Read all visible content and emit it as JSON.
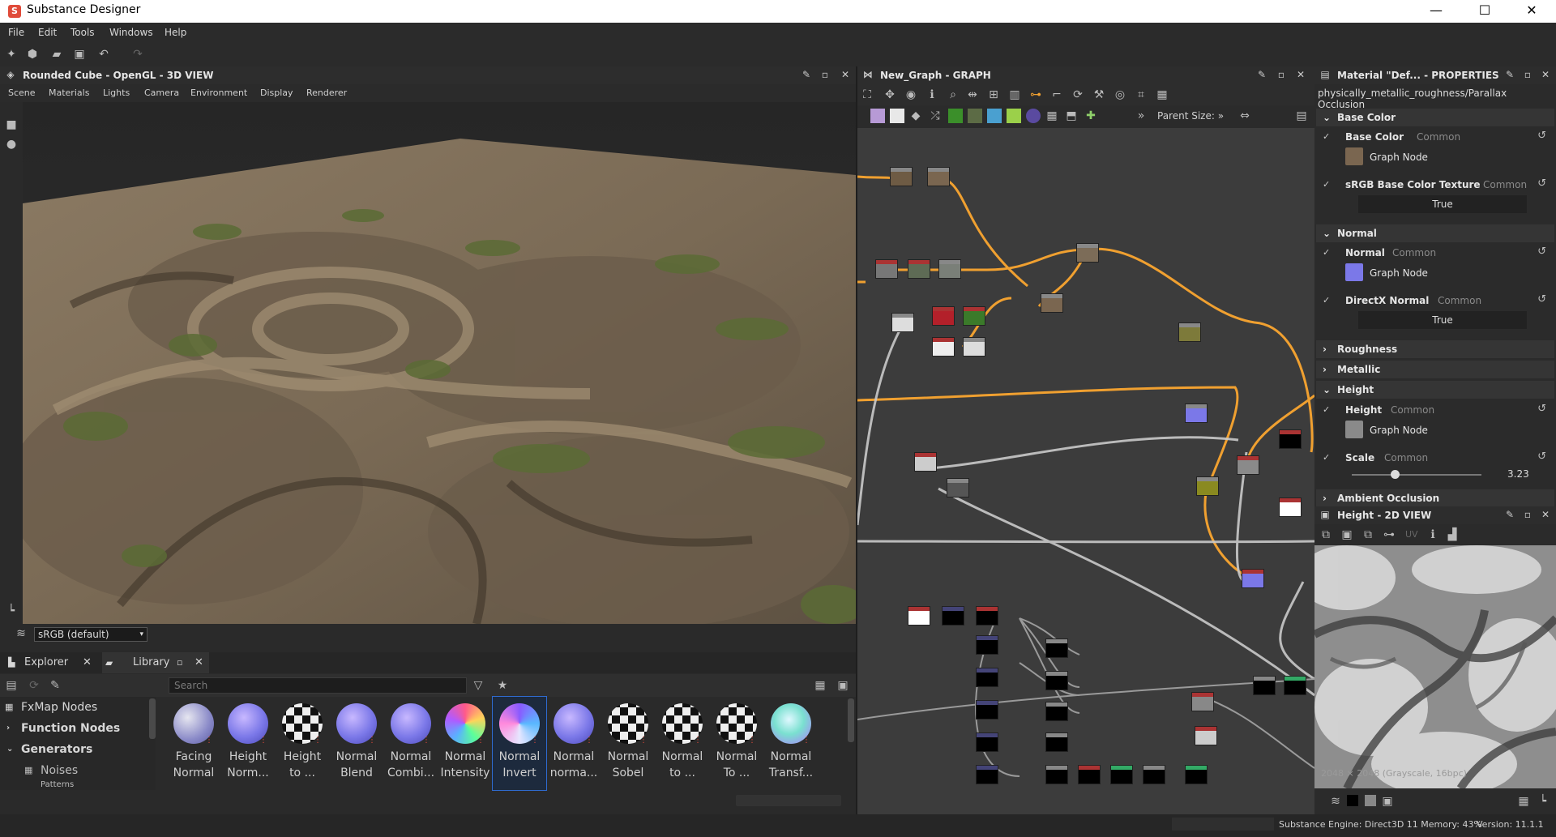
{
  "window": {
    "title": "Substance Designer",
    "minimize": "—",
    "maximize": "☐",
    "close": "✕"
  },
  "menubar": {
    "items": [
      "File",
      "Edit",
      "Tools",
      "Windows",
      "Help"
    ]
  },
  "view3d": {
    "title": "Rounded Cube - OpenGL - 3D VIEW",
    "menu": [
      "Scene",
      "Materials",
      "Lights",
      "Camera",
      "Environment",
      "Display",
      "Renderer"
    ],
    "colorspace": "sRGB (default)"
  },
  "library": {
    "tabs": [
      "Explorer",
      "Library"
    ],
    "search_placeholder": "Search",
    "tree": [
      {
        "label": "FxMap Nodes",
        "bold": false
      },
      {
        "label": "Function Nodes",
        "bold": true
      },
      {
        "label": "Generators",
        "bold": true
      },
      {
        "label": "Noises",
        "bold": false
      },
      {
        "label": "Patterns",
        "bold": false
      }
    ],
    "nodes": [
      {
        "line1": "Facing",
        "line2": "Normal",
        "style": "facing"
      },
      {
        "line1": "Height",
        "line2": "Norm...",
        "style": "normal"
      },
      {
        "line1": "Height",
        "line2": "to ...",
        "style": "checker"
      },
      {
        "line1": "Normal",
        "line2": "Blend",
        "style": "normal"
      },
      {
        "line1": "Normal",
        "line2": "Combi...",
        "style": "normal"
      },
      {
        "line1": "Normal",
        "line2": "Intensity",
        "style": "intensity"
      },
      {
        "line1": "Normal",
        "line2": "Invert",
        "style": "invert",
        "selected": true
      },
      {
        "line1": "Normal",
        "line2": "norma...",
        "style": "normal"
      },
      {
        "line1": "Normal",
        "line2": "Sobel",
        "style": "checker"
      },
      {
        "line1": "Normal",
        "line2": "to ...",
        "style": "checker"
      },
      {
        "line1": "Normal",
        "line2": "To ...",
        "style": "checker"
      },
      {
        "line1": "Normal",
        "line2": "Transf...",
        "style": "transform"
      }
    ]
  },
  "graph": {
    "title": "New_Graph - GRAPH",
    "parent_size_label": "Parent Size:",
    "parent_size_arrow": "»"
  },
  "properties": {
    "title": "Material \"Def... - PROPERTIES",
    "path": "physically_metallic_roughness/Parallax Occlusion",
    "common": "Common",
    "sections": {
      "base_color": "Base Color",
      "normal": "Normal",
      "roughness": "Roughness",
      "metallic": "Metallic",
      "height": "Height",
      "ambient_occlusion": "Ambient Occlusion"
    },
    "rows": {
      "base_color": "Base Color",
      "srgb_texture": "sRGB Base Color Texture",
      "normal": "Normal",
      "directx_normal": "DirectX Normal",
      "height": "Height",
      "scale": "Scale"
    },
    "graph_node": "Graph Node",
    "true_value": "True",
    "scale_value": "3.23",
    "scale_fraction": 0.33
  },
  "view2d": {
    "title": "Height - 2D VIEW",
    "uv_label": "UV",
    "info": "2048 × 2048 (Grayscale, 16bpc)"
  },
  "status": {
    "engine": "Substance Engine: Direct3D 11  Memory: 43%",
    "version": "Version: 11.1.1"
  },
  "colors": {
    "accent_orange": "#f0a030",
    "selection_blue": "#2f6bd0",
    "normal_map_blue": "#7b78e8"
  }
}
